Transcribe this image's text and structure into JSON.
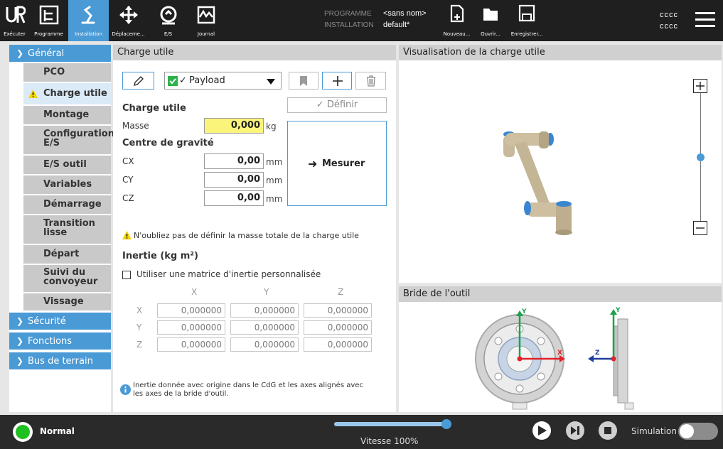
{
  "toolbar": {
    "tabs": [
      {
        "label": "Exécuter",
        "icon": "ur-logo-icon"
      },
      {
        "label": "Programme",
        "icon": "program-tree-icon"
      },
      {
        "label": "Installation",
        "icon": "installation-robot-icon"
      },
      {
        "label": "Déplaceme...",
        "icon": "move-arrows-icon"
      },
      {
        "label": "E/S",
        "icon": "io-icon"
      },
      {
        "label": "Journal",
        "icon": "log-chart-icon"
      }
    ],
    "programme_label": "PROGRAMME",
    "programme_value": "<sans nom>",
    "installation_label": "INSTALLATION",
    "installation_value": "default*",
    "file_buttons": [
      {
        "label": "Nouveau...",
        "icon": "new-file-icon"
      },
      {
        "label": "Ouvrir...",
        "icon": "folder-icon"
      },
      {
        "label": "Enregistrer...",
        "icon": "save-icon"
      }
    ],
    "user_line1": "cccc",
    "user_line2": "cccc",
    "menu_icon": "hamburger-menu-icon"
  },
  "sidebar": {
    "general": "Général",
    "items": [
      "PCO",
      "Charge utile",
      "Montage",
      "Configuration E/S",
      "E/S outil",
      "Variables",
      "Démarrage",
      "Transition lisse",
      "Départ",
      "Suivi du convoyeur",
      "Vissage"
    ],
    "selected": "Charge utile",
    "sections": [
      "Sécurité",
      "Fonctions",
      "Bus de terrain"
    ]
  },
  "payload": {
    "title": "Charge utile",
    "dropdown_value": "Payload",
    "define_button": "Définir",
    "section_label": "Charge utile",
    "mass_label": "Masse",
    "mass_value": "0,000",
    "mass_unit": "kg",
    "cog_label": "Centre de gravité",
    "cx_label": "CX",
    "cx_value": "0,00",
    "cy_label": "CY",
    "cy_value": "0,00",
    "cz_label": "CZ",
    "cz_value": "0,00",
    "mm": "mm",
    "measure_button": "Mesurer",
    "warning": "N'oubliez pas de définir la masse totale de la charge utile",
    "inertia_title": "Inertie (kg m²)",
    "custom_matrix_label": "Utiliser une matrice d'inertie personnalisée",
    "custom_matrix_checked": false,
    "axes": [
      "X",
      "Y",
      "Z"
    ],
    "matrix": [
      [
        "0,000000",
        "0,000000",
        "0,000000"
      ],
      [
        "0,000000",
        "0,000000",
        "0,000000"
      ],
      [
        "0,000000",
        "0,000000",
        "0,000000"
      ]
    ],
    "info_line1": "Inertie donnée avec origine dans le CdG et les axes alignés avec",
    "info_line2": "les axes de la bride d'outil."
  },
  "visual": {
    "title": "Visualisation de la charge utile",
    "zoom_level": 0.5
  },
  "flange": {
    "title": "Bride de l'outil",
    "axis_x": "X",
    "axis_y": "Y",
    "axis_z": "Z",
    "x_color": "#e0242b",
    "y_color": "#1aa34a",
    "z_color": "#1f3f9a"
  },
  "footer": {
    "status": "Normal",
    "status_color": "#21c021",
    "speed_label": "Vitesse 100%",
    "speed_fraction": 1.0,
    "simulation_label": "Simulation",
    "simulation_on": false
  },
  "colors": {
    "accent": "#4a9ad6",
    "header": "#1f1f1f",
    "warning": "#f5d300"
  }
}
